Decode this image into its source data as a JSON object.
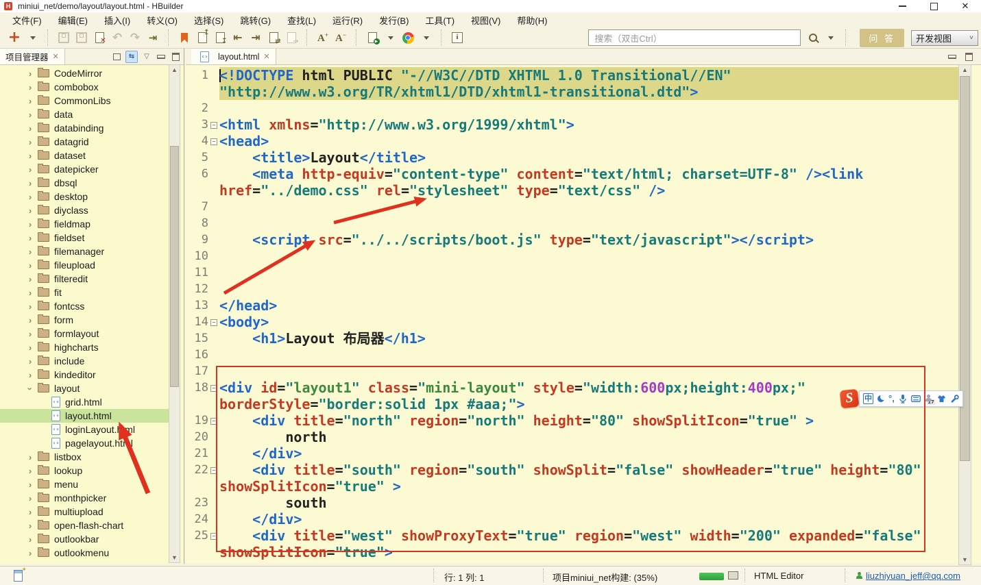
{
  "window": {
    "title": "miniui_net/demo/layout/layout.html  -  HBuilder"
  },
  "menubar": {
    "items": [
      "文件(F)",
      "编辑(E)",
      "插入(I)",
      "转义(O)",
      "选择(S)",
      "跳转(G)",
      "查找(L)",
      "运行(R)",
      "发行(B)",
      "工具(T)",
      "视图(V)",
      "帮助(H)"
    ]
  },
  "toolbar": {
    "search_placeholder": "搜索（双击Ctrl）",
    "qa_label": "问 答",
    "view_label": "开发视图",
    "font_inc": "A",
    "font_dec": "A",
    "icons": [
      "new-plus-icon",
      "save-icon",
      "save-all-icon",
      "close-file-icon",
      "undo-icon",
      "redo-icon",
      "format-icon",
      "bookmark-icon",
      "import-doc-icon",
      "export-doc-icon",
      "jump-prev-icon",
      "jump-next-icon",
      "refresh-doc-icon",
      "next-doc-icon",
      "font-increase",
      "font-decrease",
      "run-in-browser-icon",
      "chrome-icon",
      "info-icon",
      "search-icon"
    ]
  },
  "sidebar": {
    "tab_label": "项目管理器",
    "tree": [
      {
        "label": "CodeMirror",
        "type": "folder"
      },
      {
        "label": "combobox",
        "type": "folder"
      },
      {
        "label": "CommonLibs",
        "type": "folder"
      },
      {
        "label": "data",
        "type": "folder"
      },
      {
        "label": "databinding",
        "type": "folder"
      },
      {
        "label": "datagrid",
        "type": "folder"
      },
      {
        "label": "dataset",
        "type": "folder"
      },
      {
        "label": "datepicker",
        "type": "folder"
      },
      {
        "label": "dbsql",
        "type": "folder"
      },
      {
        "label": "desktop",
        "type": "folder"
      },
      {
        "label": "diyclass",
        "type": "folder"
      },
      {
        "label": "fieldmap",
        "type": "folder"
      },
      {
        "label": "fieldset",
        "type": "folder"
      },
      {
        "label": "filemanager",
        "type": "folder"
      },
      {
        "label": "fileupload",
        "type": "folder"
      },
      {
        "label": "filteredit",
        "type": "folder"
      },
      {
        "label": "fit",
        "type": "folder"
      },
      {
        "label": "fontcss",
        "type": "folder"
      },
      {
        "label": "form",
        "type": "folder"
      },
      {
        "label": "formlayout",
        "type": "folder"
      },
      {
        "label": "highcharts",
        "type": "folder"
      },
      {
        "label": "include",
        "type": "folder"
      },
      {
        "label": "kindeditor",
        "type": "folder"
      },
      {
        "label": "layout",
        "type": "folder",
        "expanded": true
      },
      {
        "label": "grid.html",
        "type": "file"
      },
      {
        "label": "layout.html",
        "type": "file",
        "selected": true
      },
      {
        "label": "loginLayout.html",
        "type": "file"
      },
      {
        "label": "pagelayout.html",
        "type": "file"
      },
      {
        "label": "listbox",
        "type": "folder"
      },
      {
        "label": "lookup",
        "type": "folder"
      },
      {
        "label": "menu",
        "type": "folder"
      },
      {
        "label": "monthpicker",
        "type": "folder"
      },
      {
        "label": "multiupload",
        "type": "folder"
      },
      {
        "label": "open-flash-chart",
        "type": "folder"
      },
      {
        "label": "outlookbar",
        "type": "folder"
      },
      {
        "label": "outlookmenu",
        "type": "folder"
      }
    ]
  },
  "editor": {
    "tab_label": "layout.html",
    "lines": [
      {
        "n": 1,
        "hl": true,
        "caret": true,
        "rows": [
          [
            [
              "t",
              "<!DOCTYPE"
            ],
            [
              "p",
              " html PUBLIC "
            ],
            [
              "s",
              "\"-//W3C//DTD XHTML 1.0 Transitional//EN\""
            ]
          ],
          [
            [
              "s",
              "\"http://www.w3.org/TR/xhtml1/DTD/xhtml1-transitional.dtd\""
            ],
            [
              "t",
              ">"
            ]
          ]
        ]
      },
      {
        "n": 2,
        "rows": [
          []
        ]
      },
      {
        "n": 3,
        "fold": true,
        "rows": [
          [
            [
              "t",
              "<html "
            ],
            [
              "a",
              "xmlns"
            ],
            [
              "p",
              "="
            ],
            [
              "s",
              "\"http://www.w3.org/1999/xhtml\""
            ],
            [
              "t",
              ">"
            ]
          ]
        ]
      },
      {
        "n": 4,
        "fold": true,
        "rows": [
          [
            [
              "t",
              "<head>"
            ]
          ]
        ]
      },
      {
        "n": 5,
        "rows": [
          [
            [
              "p",
              "    "
            ],
            [
              "t",
              "<title>"
            ],
            [
              "p",
              "Layout"
            ],
            [
              "t",
              "</title>"
            ]
          ]
        ]
      },
      {
        "n": 6,
        "rows": [
          [
            [
              "p",
              "    "
            ],
            [
              "t",
              "<meta "
            ],
            [
              "a",
              "http-equiv"
            ],
            [
              "p",
              "="
            ],
            [
              "s",
              "\"content-type\""
            ],
            [
              "p",
              " "
            ],
            [
              "a",
              "content"
            ],
            [
              "p",
              "="
            ],
            [
              "s",
              "\"text/html; charset=UTF-8\""
            ],
            [
              "t",
              " /><link"
            ]
          ],
          [
            [
              "a",
              "href"
            ],
            [
              "p",
              "="
            ],
            [
              "s",
              "\"../demo.css\""
            ],
            [
              "p",
              " "
            ],
            [
              "a",
              "rel"
            ],
            [
              "p",
              "="
            ],
            [
              "s",
              "\"stylesheet\""
            ],
            [
              "p",
              " "
            ],
            [
              "a",
              "type"
            ],
            [
              "p",
              "="
            ],
            [
              "s",
              "\"text/css\""
            ],
            [
              "t",
              " />"
            ]
          ]
        ]
      },
      {
        "n": 7,
        "rows": [
          []
        ]
      },
      {
        "n": 8,
        "rows": [
          []
        ]
      },
      {
        "n": 9,
        "rows": [
          [
            [
              "p",
              "    "
            ],
            [
              "t",
              "<script "
            ],
            [
              "a",
              "src"
            ],
            [
              "p",
              "="
            ],
            [
              "s",
              "\"../../scripts/boot.js\""
            ],
            [
              "p",
              " "
            ],
            [
              "a",
              "type"
            ],
            [
              "p",
              "="
            ],
            [
              "s",
              "\"text/javascript\""
            ],
            [
              "t",
              "></script>"
            ]
          ]
        ]
      },
      {
        "n": 10,
        "rows": [
          []
        ]
      },
      {
        "n": 11,
        "rows": [
          []
        ]
      },
      {
        "n": 12,
        "rows": [
          []
        ]
      },
      {
        "n": 13,
        "rows": [
          [
            [
              "t",
              "</head>"
            ]
          ]
        ]
      },
      {
        "n": 14,
        "fold": true,
        "rows": [
          [
            [
              "t",
              "<body>"
            ]
          ]
        ]
      },
      {
        "n": 15,
        "rows": [
          [
            [
              "p",
              "    "
            ],
            [
              "t",
              "<h1>"
            ],
            [
              "p",
              "Layout 布局器"
            ],
            [
              "t",
              "</h1>"
            ]
          ]
        ]
      },
      {
        "n": 16,
        "rows": [
          []
        ]
      },
      {
        "n": 17,
        "rows": [
          []
        ]
      },
      {
        "n": 18,
        "fold": true,
        "rows": [
          [
            [
              "t",
              "<div "
            ],
            [
              "a",
              "id"
            ],
            [
              "p",
              "="
            ],
            [
              "s",
              "\""
            ],
            [
              "v",
              "layout1"
            ],
            [
              "s",
              "\""
            ],
            [
              "p",
              " "
            ],
            [
              "a",
              "class"
            ],
            [
              "p",
              "="
            ],
            [
              "s",
              "\""
            ],
            [
              "v",
              "mini-layout"
            ],
            [
              "s",
              "\""
            ],
            [
              "p",
              " "
            ],
            [
              "a",
              "style"
            ],
            [
              "p",
              "="
            ],
            [
              "s",
              "\"width:"
            ],
            [
              "n",
              "600"
            ],
            [
              "s",
              "px;height:"
            ],
            [
              "n",
              "400"
            ],
            [
              "s",
              "px;\""
            ]
          ],
          [
            [
              "a",
              "borderStyle"
            ],
            [
              "p",
              "="
            ],
            [
              "s",
              "\"border:solid 1px #aaa;\""
            ],
            [
              "t",
              ">"
            ]
          ]
        ]
      },
      {
        "n": 19,
        "fold": true,
        "rows": [
          [
            [
              "p",
              "    "
            ],
            [
              "t",
              "<div "
            ],
            [
              "a",
              "title"
            ],
            [
              "p",
              "="
            ],
            [
              "s",
              "\"north\""
            ],
            [
              "p",
              " "
            ],
            [
              "a",
              "region"
            ],
            [
              "p",
              "="
            ],
            [
              "s",
              "\"north\""
            ],
            [
              "p",
              " "
            ],
            [
              "a",
              "height"
            ],
            [
              "p",
              "="
            ],
            [
              "s",
              "\"80\""
            ],
            [
              "p",
              " "
            ],
            [
              "a",
              "showSplitIcon"
            ],
            [
              "p",
              "="
            ],
            [
              "s",
              "\"true\""
            ],
            [
              "p",
              " "
            ],
            [
              "t",
              ">"
            ]
          ]
        ]
      },
      {
        "n": 20,
        "rows": [
          [
            [
              "p",
              "        north"
            ]
          ]
        ]
      },
      {
        "n": 21,
        "rows": [
          [
            [
              "p",
              "    "
            ],
            [
              "t",
              "</div>"
            ]
          ]
        ]
      },
      {
        "n": 22,
        "fold": true,
        "rows": [
          [
            [
              "p",
              "    "
            ],
            [
              "t",
              "<div "
            ],
            [
              "a",
              "title"
            ],
            [
              "p",
              "="
            ],
            [
              "s",
              "\"south\""
            ],
            [
              "p",
              " "
            ],
            [
              "a",
              "region"
            ],
            [
              "p",
              "="
            ],
            [
              "s",
              "\"south\""
            ],
            [
              "p",
              " "
            ],
            [
              "a",
              "showSplit"
            ],
            [
              "p",
              "="
            ],
            [
              "s",
              "\"false\""
            ],
            [
              "p",
              " "
            ],
            [
              "a",
              "showHeader"
            ],
            [
              "p",
              "="
            ],
            [
              "s",
              "\"true\""
            ],
            [
              "p",
              " "
            ],
            [
              "a",
              "height"
            ],
            [
              "p",
              "="
            ],
            [
              "s",
              "\"80\""
            ]
          ],
          [
            [
              "a",
              "showSplitIcon"
            ],
            [
              "p",
              "="
            ],
            [
              "s",
              "\"true\""
            ],
            [
              "p",
              " "
            ],
            [
              "t",
              ">"
            ]
          ]
        ]
      },
      {
        "n": 23,
        "rows": [
          [
            [
              "p",
              "        south"
            ]
          ]
        ]
      },
      {
        "n": 24,
        "rows": [
          [
            [
              "p",
              "    "
            ],
            [
              "t",
              "</div>"
            ]
          ]
        ]
      },
      {
        "n": 25,
        "fold": true,
        "rows": [
          [
            [
              "p",
              "    "
            ],
            [
              "t",
              "<div "
            ],
            [
              "a",
              "title"
            ],
            [
              "p",
              "="
            ],
            [
              "s",
              "\"west\""
            ],
            [
              "p",
              " "
            ],
            [
              "a",
              "showProxyText"
            ],
            [
              "p",
              "="
            ],
            [
              "s",
              "\"true\""
            ],
            [
              "p",
              " "
            ],
            [
              "a",
              "region"
            ],
            [
              "p",
              "="
            ],
            [
              "s",
              "\"west\""
            ],
            [
              "p",
              " "
            ],
            [
              "a",
              "width"
            ],
            [
              "p",
              "="
            ],
            [
              "s",
              "\"200\""
            ],
            [
              "p",
              " "
            ],
            [
              "a",
              "expanded"
            ],
            [
              "p",
              "="
            ],
            [
              "s",
              "\"false\""
            ]
          ],
          [
            [
              "a",
              "showSplitIcon"
            ],
            [
              "p",
              "="
            ],
            [
              "s",
              "\"true\""
            ],
            [
              "t",
              ">"
            ]
          ]
        ]
      }
    ]
  },
  "statusbar": {
    "cursor": "行: 1 列: 1",
    "build": "项目miniui_net构建: (35%)",
    "editor_mode": "HTML Editor",
    "user_email": "liuzhiyuan_jeff@qq.com"
  },
  "ime": {
    "skin_badge": "17",
    "zh_label": "中",
    "icons": [
      "sogou-logo",
      "chinese-mode-icon",
      "moon-icon",
      "punctuation-icon",
      "microphone-icon",
      "keyboard-icon",
      "skin-person-icon",
      "tshirt-icon",
      "wrench-icon"
    ]
  },
  "colors": {
    "accent_red": "#d6361f",
    "tag_blue": "#2166c9",
    "attr_red": "#c13a22",
    "string_teal": "#177a7a",
    "selection_green": "#cbe49b"
  }
}
